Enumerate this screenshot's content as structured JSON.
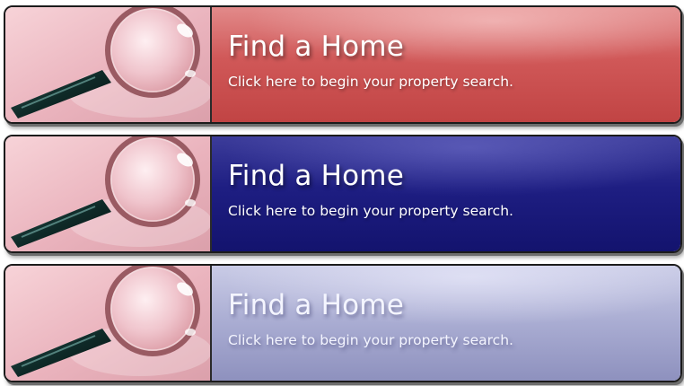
{
  "banners": [
    {
      "state": "normal",
      "title": "Find a Home",
      "subtitle": "Click here to begin your property search.",
      "accent_color": "#c94b4b",
      "icon": "magnifying-glass-icon"
    },
    {
      "state": "hover",
      "title": "Find a Home",
      "subtitle": "Click here to begin your property search.",
      "accent_color": "#1a1a7a",
      "icon": "magnifying-glass-icon"
    },
    {
      "state": "pressed",
      "title": "Find a Home",
      "subtitle": "Click here to begin your property search.",
      "accent_color": "#a6a9cf",
      "icon": "magnifying-glass-icon"
    }
  ]
}
